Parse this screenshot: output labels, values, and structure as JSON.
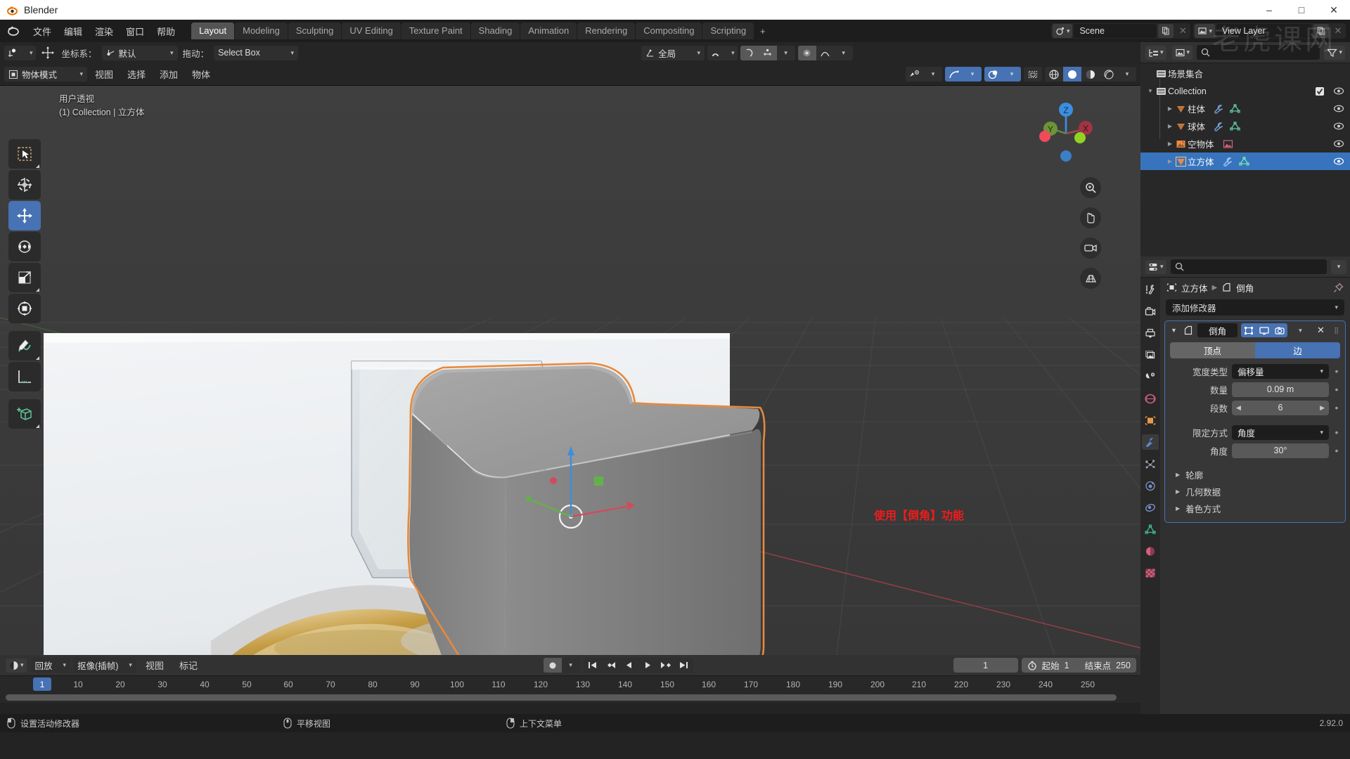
{
  "window": {
    "title": "Blender",
    "controls": {
      "minimize": "–",
      "maximize": "□",
      "close": "✕"
    }
  },
  "topbar": {
    "menus": [
      "文件",
      "编辑",
      "渲染",
      "窗口",
      "帮助"
    ],
    "workspace_tabs": [
      "Layout",
      "Modeling",
      "Sculpting",
      "UV Editing",
      "Texture Paint",
      "Shading",
      "Animation",
      "Rendering",
      "Compositing",
      "Scripting"
    ],
    "active_tab": "Layout",
    "add_tab": "+",
    "scene_name": "Scene",
    "view_layer_name": "View Layer"
  },
  "watermark": "老虎课网",
  "viewport": {
    "header": {
      "transform_orientation_label": "坐标系：",
      "transform_orientation_value": "默认",
      "drag_label": "拖动：",
      "drag_value": "Select Box",
      "global_value": "全局"
    },
    "header2": {
      "mode": "物体模式",
      "menus": [
        "视图",
        "选择",
        "添加",
        "物体"
      ]
    },
    "overlay_line1": "用户透视",
    "overlay_line2": "(1) Collection | 立方体",
    "annotation": "使用【倒角】功能",
    "gizmo_axes": [
      "Z",
      "Y",
      "X"
    ],
    "tools": [
      "tweak-select-tool",
      "cursor-tool",
      "move-tool",
      "rotate-tool",
      "scale-tool",
      "transform-tool",
      "annotate-tool",
      "measure-tool",
      "add-cube-tool"
    ],
    "active_tool": "move-tool"
  },
  "outliner": {
    "search_placeholder": "",
    "scene_collection": "场景集合",
    "rows": [
      {
        "label": "Collection",
        "indent": 0,
        "type": "collection",
        "selected": false,
        "checkbox": true
      },
      {
        "label": "柱体",
        "indent": 1,
        "type": "mesh",
        "selected": false,
        "modifier": true
      },
      {
        "label": "球体",
        "indent": 1,
        "type": "mesh",
        "selected": false,
        "modifier": true
      },
      {
        "label": "空物体",
        "indent": 1,
        "type": "image",
        "selected": false,
        "modifier": false
      },
      {
        "label": "立方体",
        "indent": 1,
        "type": "mesh",
        "selected": true,
        "modifier": true
      }
    ]
  },
  "properties": {
    "breadcrumb_object": "立方体",
    "breadcrumb_modifier": "倒角",
    "add_modifier": "添加修改器",
    "modifier_name": "倒角",
    "segmented": {
      "left": "顶点",
      "right": "边",
      "active": "right"
    },
    "fields": [
      {
        "label": "宽度类型",
        "value": "偏移量",
        "style": "dropdown"
      },
      {
        "label": "数量",
        "value": "0.09 m",
        "style": "value"
      },
      {
        "label": "段数",
        "value": "6",
        "style": "spinner"
      }
    ],
    "fields2": [
      {
        "label": "限定方式",
        "value": "角度",
        "style": "dropdown"
      },
      {
        "label": "角度",
        "value": "30°",
        "style": "value"
      }
    ],
    "subpanels": [
      "轮廓",
      "几何数据",
      "着色方式"
    ],
    "tabs": [
      "tool-tab",
      "render-tab",
      "output-tab",
      "view-layer-tab",
      "scene-tab",
      "world-tab",
      "object-tab",
      "modifier-tab",
      "particles-tab",
      "physics-tab",
      "constraints-tab",
      "data-tab",
      "material-tab",
      "texture-tab"
    ],
    "active_tab": "modifier-tab"
  },
  "timeline": {
    "menus": [
      "回放",
      "抠像(插帧)",
      "视图",
      "标记"
    ],
    "current_frame": "1",
    "start_label": "起始",
    "start_value": "1",
    "end_label": "结束点",
    "end_value": "250",
    "ticks": [
      10,
      20,
      30,
      40,
      50,
      60,
      70,
      80,
      90,
      100,
      110,
      120,
      130,
      140,
      150,
      160,
      170,
      180,
      190,
      200,
      210,
      220,
      230,
      240,
      250
    ],
    "playhead_frame": "1"
  },
  "statusbar": {
    "items": [
      "设置活动修改器",
      "平移视图",
      "上下文菜单"
    ],
    "version": "2.92.0"
  },
  "colors": {
    "accent": "#4772b3",
    "annotation": "#ef1c1c",
    "selected_outline": "#e8893b",
    "mesh_icon": "#5ec49a",
    "object_icon": "#f0893f"
  }
}
